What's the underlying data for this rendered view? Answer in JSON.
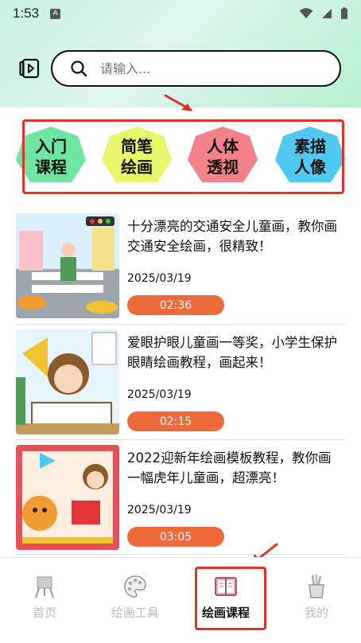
{
  "status_bar": {
    "time": "1:53",
    "indicator": "A"
  },
  "search": {
    "placeholder": "请输入..."
  },
  "categories": [
    {
      "label": "入门\n课程",
      "color": "#6ee5a3"
    },
    {
      "label": "简笔\n绘画",
      "color": "#e9f56b"
    },
    {
      "label": "人体\n透视",
      "color": "#f4808a"
    },
    {
      "label": "素描\n人像",
      "color": "#4fc9ef"
    }
  ],
  "courses": [
    {
      "title": "十分漂亮的交通安全儿童画，教你画交通安全绘画，很精致！",
      "date": "2025/03/19",
      "duration": "02:36"
    },
    {
      "title": "爱眼护眼儿童画一等奖，小学生保护眼睛绘画教程，画起来！",
      "date": "2025/03/19",
      "duration": "02:15"
    },
    {
      "title": "2022迎新年绘画模板教程，教你画一幅虎年儿童画，超漂亮！",
      "date": "2025/03/19",
      "duration": "03:05"
    }
  ],
  "nav": {
    "items": [
      {
        "label": "首页",
        "icon": "easel-icon"
      },
      {
        "label": "绘画工具",
        "icon": "palette-icon"
      },
      {
        "label": "绘画课程",
        "icon": "book-icon"
      },
      {
        "label": "我的",
        "icon": "pencil-cup-icon"
      }
    ],
    "active": "绘画课程"
  },
  "colors": {
    "accent": "#ef6a3a",
    "annotation": "#e0312b"
  }
}
